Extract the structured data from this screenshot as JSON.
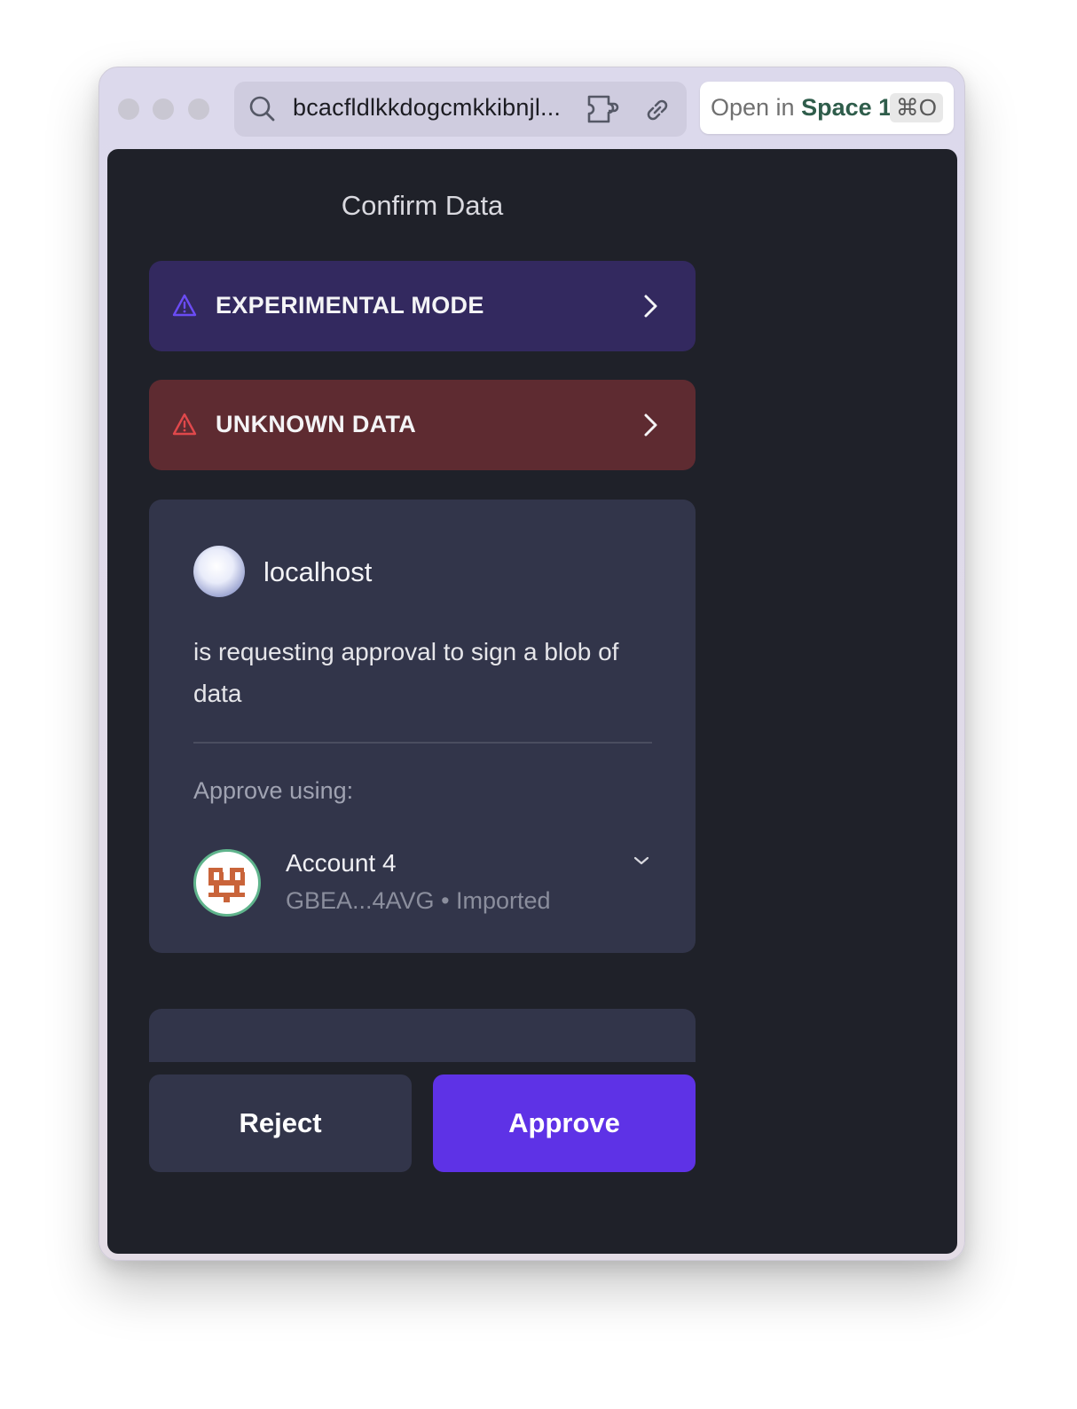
{
  "browser": {
    "url_text": "bcacfldlkkdogcmkkibnjl...",
    "open_in_prefix": "Open in",
    "open_in_space": "Space 1",
    "shortcut": "⌘O"
  },
  "page": {
    "title": "Confirm Data"
  },
  "banners": [
    {
      "label": "EXPERIMENTAL MODE",
      "icon": "warning-triangle-icon",
      "color": "#33295f",
      "icon_color": "#6b4cf5"
    },
    {
      "label": "UNKNOWN DATA",
      "icon": "warning-triangle-icon",
      "color": "#5e2b31",
      "icon_color": "#e0484b"
    }
  ],
  "request": {
    "site": "localhost",
    "description": "is requesting approval to sign a blob of data"
  },
  "approve": {
    "label": "Approve using:",
    "account_name": "Account 4",
    "account_sub": "GBEA...4AVG • Imported",
    "avatar_accent": "#c9643a"
  },
  "actions": {
    "reject": "Reject",
    "approve": "Approve",
    "approve_color": "#5e32e6"
  }
}
